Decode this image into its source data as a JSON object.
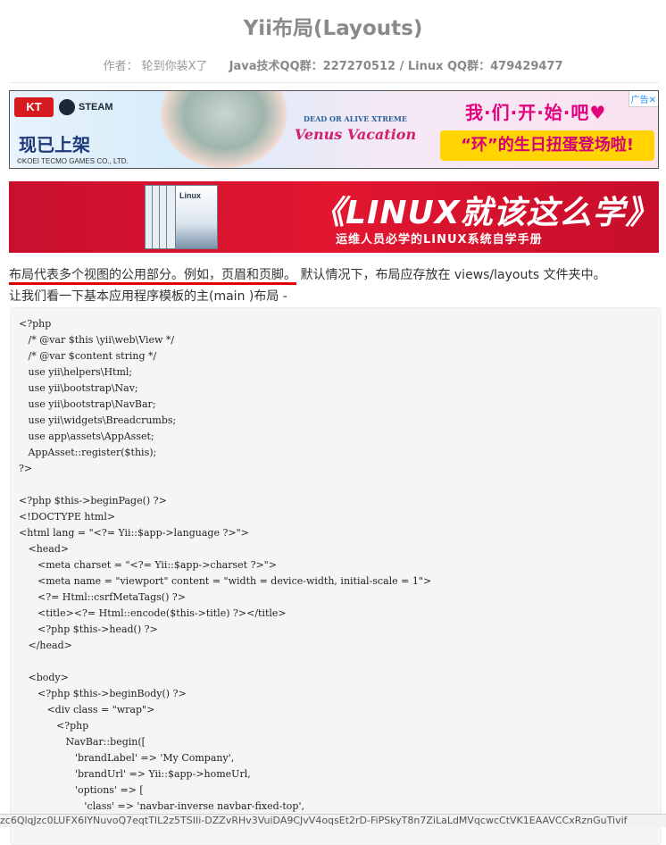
{
  "page": {
    "title": "Yii布局(Layouts)",
    "author": "作者： 轮到你装X了",
    "qq": "Java技术QQ群：227270512 / Linux QQ群：479429477"
  },
  "ad1": {
    "brand_kt": "KT",
    "brand_steam": "STEAM",
    "on_sale": "现已上架",
    "copyright": "©KOEI TECMO GAMES CO., LTD.",
    "logo_line1": "DEAD OR ALIVE XTREME",
    "logo_line2": "Venus Vacation",
    "slogan1": "我·们·开·始·吧♥",
    "slogan2": "“环”的生日扭蛋登场啦!",
    "ad_tag": "广告✕"
  },
  "ad2": {
    "headline": "《LINUX就该这么学》",
    "subline": "运维人员必学的LINUX系统自学手册"
  },
  "intro": {
    "highlight": "布局代表多个视图的公用部分。例如，页眉和页脚。",
    "rest": " 默认情况下，布局应存放在 views/layouts 文件夹中。",
    "line2": "让我们看一下基本应用程序模板的主(main )布局 -"
  },
  "code": {
    "text": "<?php\n   /* @var $this \\yii\\web\\View */\n   /* @var $content string */\n   use yii\\helpers\\Html;\n   use yii\\bootstrap\\Nav;\n   use yii\\bootstrap\\NavBar;\n   use yii\\widgets\\Breadcrumbs;\n   use app\\assets\\AppAsset;\n   AppAsset::register($this);\n?>\n\n<?php $this->beginPage() ?>\n<!DOCTYPE html>\n<html lang = \"<?= Yii::$app->language ?>\">\n   <head>\n      <meta charset = \"<?= Yii::$app->charset ?>\">\n      <meta name = \"viewport\" content = \"width = device-width, initial-scale = 1\">\n      <?= Html::csrfMetaTags() ?>\n      <title><?= Html::encode($this->title) ?></title>\n      <?php $this->head() ?>\n   </head>\n\n   <body>\n      <?php $this->beginBody() ?>\n         <div class = \"wrap\">\n            <?php\n               NavBar::begin([\n                  'brandLabel' => 'My Company',\n                  'brandUrl' => Yii::$app->homeUrl,\n                  'options' => [\n                     'class' => 'navbar-inverse navbar-fixed-top',"
  },
  "url_strip": "zc6QlqJzc0LUFX6IYNuvoQ7eqtTIL2z5TSIIi-DZZvRHv3VuiDA9CJvV4oqsEt2rD-FiPSkyT8n7ZiLaLdMVqcwcCtVK1EAAVCCxRznGuTivif"
}
